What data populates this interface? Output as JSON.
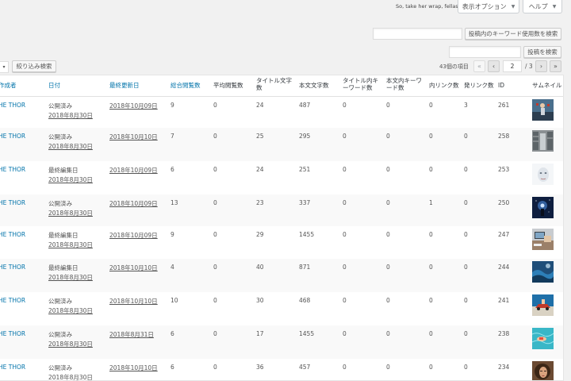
{
  "top_note": "So, take her wrap, fellas",
  "screen_options": {
    "label": "表示オプション",
    "caret": "▼"
  },
  "help": {
    "label": "ヘルプ",
    "caret": "▼"
  },
  "keyword_search": {
    "value": "",
    "button": "投稿内のキーワード使用数を検索"
  },
  "post_search": {
    "value": "",
    "button": "投稿を検索"
  },
  "filter": {
    "select_caret": "▾",
    "button": "絞り込み検索"
  },
  "pagination": {
    "items_count": "43個の項目",
    "first": "«",
    "prev": "‹",
    "current_page": "2",
    "total": "/ 3",
    "next": "›",
    "last": "»"
  },
  "columns": {
    "author": "作成者",
    "date": "日付",
    "modified": "最終更新日",
    "total_views": "総合閲覧数",
    "avg_views": "平均閲覧数",
    "title_chars": "タイトル文字数",
    "body_chars": "本文文字数",
    "title_kw": "タイトル内キーワード数",
    "body_kw": "本文内キーワード数",
    "internal_links": "内リンク数",
    "external_links": "発リンク数",
    "id": "ID",
    "thumbnail": "サムネイル"
  },
  "rows": [
    {
      "author": "HE THOR",
      "status": "公開済み",
      "date": "2018年8月30日",
      "modified": "2018年10月09日",
      "total_views": "9",
      "avg_views": "0",
      "title_chars": "24",
      "body_chars": "487",
      "title_kw": "0",
      "body_kw": "0",
      "internal_links": "0",
      "external_links": "3",
      "id": "261",
      "thumb_icon": "thumbnail-fighter-photo"
    },
    {
      "author": "HE THOR",
      "status": "公開済み",
      "date": "2018年8月30日",
      "modified": "2018年10月10日",
      "total_views": "7",
      "avg_views": "0",
      "title_chars": "25",
      "body_chars": "295",
      "title_kw": "0",
      "body_kw": "0",
      "internal_links": "0",
      "external_links": "0",
      "id": "258",
      "thumb_icon": "thumbnail-library-photo"
    },
    {
      "author": "HE THOR",
      "status": "最終編集日",
      "date": "2018年8月30日",
      "modified": "2018年10月09日",
      "total_views": "6",
      "avg_views": "0",
      "title_chars": "24",
      "body_chars": "251",
      "title_kw": "0",
      "body_kw": "0",
      "internal_links": "0",
      "external_links": "0",
      "id": "253",
      "thumb_icon": "thumbnail-face-photo"
    },
    {
      "author": "HE THOR",
      "status": "公開済み",
      "date": "2018年8月30日",
      "modified": "2018年10月09日",
      "total_views": "13",
      "avg_views": "0",
      "title_chars": "23",
      "body_chars": "337",
      "title_kw": "0",
      "body_kw": "0",
      "internal_links": "1",
      "external_links": "0",
      "id": "250",
      "thumb_icon": "thumbnail-night-photo"
    },
    {
      "author": "HE THOR",
      "status": "最終編集日",
      "date": "2018年8月30日",
      "modified": "2018年10月09日",
      "total_views": "9",
      "avg_views": "0",
      "title_chars": "29",
      "body_chars": "1455",
      "title_kw": "0",
      "body_kw": "0",
      "internal_links": "0",
      "external_links": "0",
      "id": "247",
      "thumb_icon": "thumbnail-desk-photo"
    },
    {
      "author": "HE THOR",
      "status": "最終編集日",
      "date": "2018年8月30日",
      "modified": "2018年10月10日",
      "total_views": "4",
      "avg_views": "0",
      "title_chars": "40",
      "body_chars": "871",
      "title_kw": "0",
      "body_kw": "0",
      "internal_links": "0",
      "external_links": "0",
      "id": "244",
      "thumb_icon": "thumbnail-ocean-photo"
    },
    {
      "author": "HE THOR",
      "status": "公開済み",
      "date": "2018年8月30日",
      "modified": "2018年10月10日",
      "total_views": "10",
      "avg_views": "0",
      "title_chars": "30",
      "body_chars": "468",
      "title_kw": "0",
      "body_kw": "0",
      "internal_links": "0",
      "external_links": "0",
      "id": "241",
      "thumb_icon": "thumbnail-red-car-photo"
    },
    {
      "author": "HE THOR",
      "status": "公開済み",
      "date": "2018年8月30日",
      "modified": "2018年8月31日",
      "total_views": "6",
      "avg_views": "0",
      "title_chars": "17",
      "body_chars": "1455",
      "title_kw": "0",
      "body_kw": "0",
      "internal_links": "0",
      "external_links": "0",
      "id": "238",
      "thumb_icon": "thumbnail-pool-photo"
    },
    {
      "author": "HE THOR",
      "status": "公開済み",
      "date": "2018年8月30日",
      "modified": "2018年10月10日",
      "total_views": "6",
      "avg_views": "0",
      "title_chars": "36",
      "body_chars": "457",
      "title_kw": "0",
      "body_kw": "0",
      "internal_links": "0",
      "external_links": "0",
      "id": "234",
      "thumb_icon": "thumbnail-portrait-photo"
    }
  ],
  "colors": {
    "link": "#0073aa",
    "text": "#555555",
    "border": "#e1e1e1",
    "background": "#f1f1f1"
  }
}
